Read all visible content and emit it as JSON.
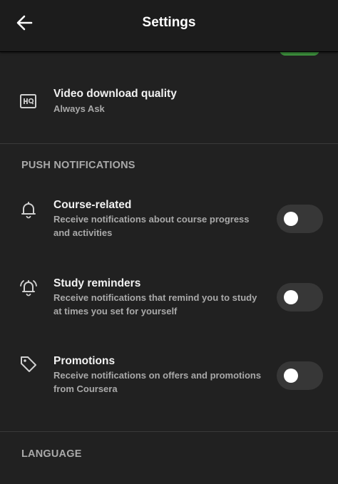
{
  "header": {
    "title": "Settings",
    "back_icon": "arrow-left-icon"
  },
  "video_quality": {
    "icon": "hq-icon",
    "title": "Video download quality",
    "value": "Always Ask"
  },
  "push_notifications": {
    "section_title": "PUSH NOTIFICATIONS",
    "items": [
      {
        "icon": "bell-icon",
        "title": "Course-related",
        "subtitle_line1": "Receive notifications about course progress",
        "subtitle_line2": "and activities",
        "enabled": false
      },
      {
        "icon": "alarm-bell-icon",
        "title": "Study reminders",
        "subtitle_line1": "Receive notifications that remind you to study",
        "subtitle_line2": "at times you set for yourself",
        "enabled": false
      },
      {
        "icon": "tag-icon",
        "title": "Promotions",
        "subtitle_line1": "Receive notifications on offers and promotions",
        "subtitle_line2": "from Coursera",
        "enabled": false
      }
    ]
  },
  "language": {
    "section_title": "LANGUAGE"
  },
  "colors": {
    "background": "#212121",
    "toggle_off_track": "#373737",
    "toggle_on_track": "#3c8f3c",
    "subtitle": "#a9a9a9"
  }
}
